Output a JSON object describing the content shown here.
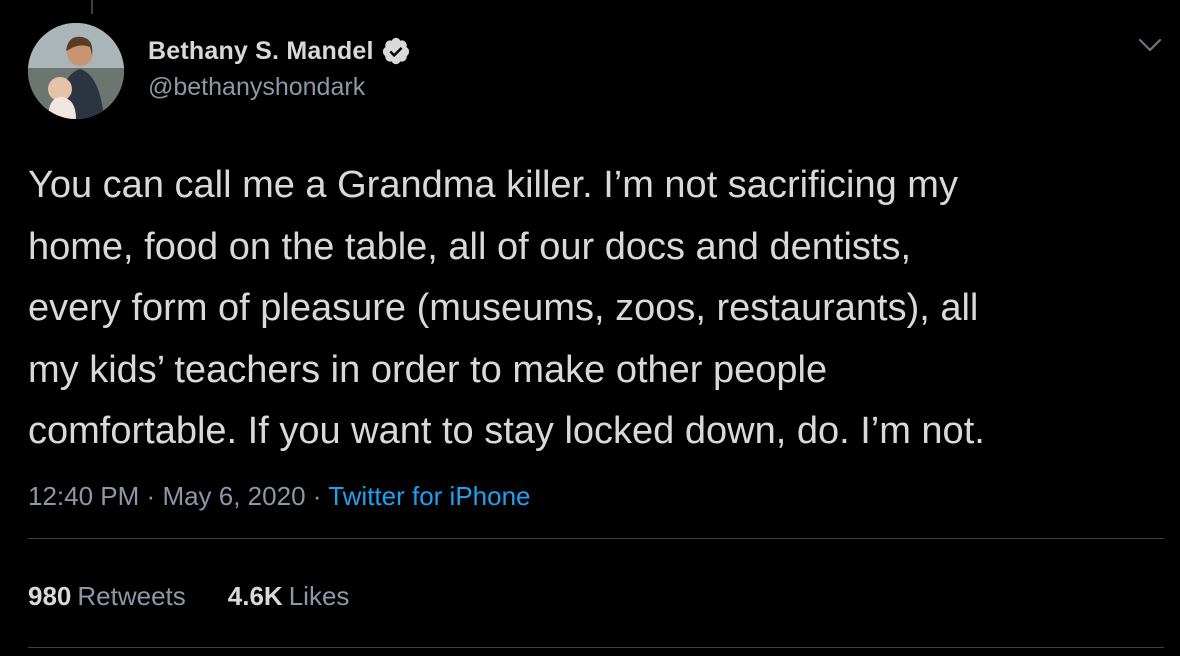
{
  "author": {
    "display_name": "Bethany S. Mandel",
    "handle": "@bethanyshondark",
    "verified": true
  },
  "tweet": {
    "text_lines": [
      "You can call me a Grandma killer. I’m not sacrificing my",
      "home, food on the table, all of our docs and dentists,",
      "every form of pleasure (museums, zoos, restaurants), all",
      "my kids’ teachers in order to make other people",
      "comfortable. If you want to stay locked down, do. I’m not."
    ],
    "time": "12:40 PM",
    "date": "May 6, 2020",
    "separator": "·",
    "source": "Twitter for iPhone"
  },
  "stats": {
    "retweets_count": "980",
    "retweets_label": "Retweets",
    "likes_count": "4.6K",
    "likes_label": "Likes"
  },
  "icons": {
    "verified": "verified-badge-icon",
    "menu": "chevron-down-icon"
  },
  "colors": {
    "background": "#000000",
    "primary_text": "#d9d9d9",
    "secondary_text": "#8b98a5",
    "link": "#1da1f2",
    "divider": "#38444d"
  }
}
